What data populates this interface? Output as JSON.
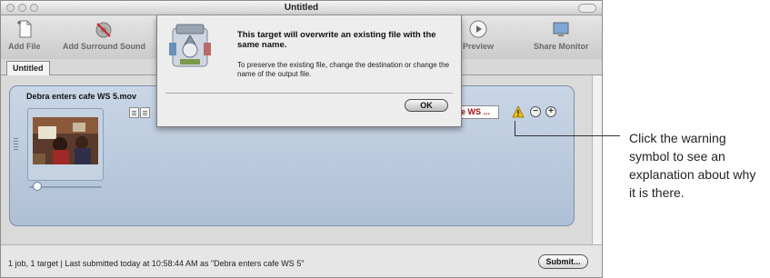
{
  "window": {
    "title": "Untitled"
  },
  "toolbar": {
    "add_file": "Add File",
    "add_surround_sound": "Add Surround Sound",
    "preview": "Preview",
    "share_monitor": "Share Monitor"
  },
  "tabs": [
    {
      "label": "Untitled",
      "selected": true
    }
  ],
  "job": {
    "source_name": "Debra enters cafe WS 5.mov",
    "output_field_value": "cafe WS ...",
    "warning_color": "#f2c200",
    "output_text_color": "#9a1010"
  },
  "dialog": {
    "heading": "This target will overwrite an existing file with the same name.",
    "body": "To preserve the existing file, change the destination or change the name of the output file.",
    "ok_label": "OK"
  },
  "status": {
    "text": "1 job, 1 target  |  Last submitted today at 10:58:44 AM as \"Debra enters cafe WS 5\"",
    "submit_label": "Submit..."
  },
  "callout": {
    "text": "Click the warning symbol to see an explanation about why it is there."
  }
}
